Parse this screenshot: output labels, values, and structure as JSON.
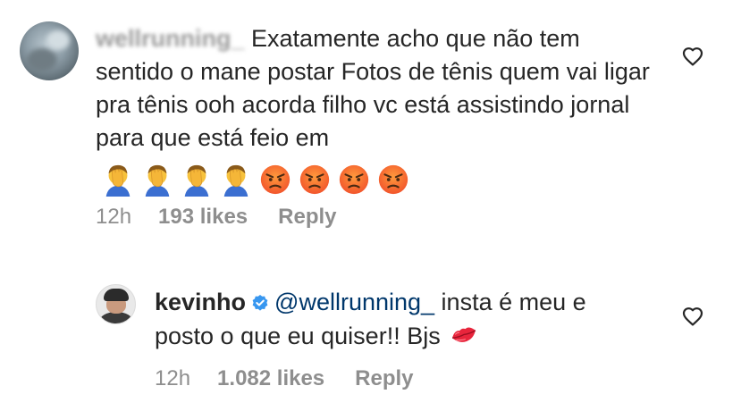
{
  "comment_1": {
    "username": "wellrunning_",
    "text": "Exatamente acho que não tem sentido o mane postar Fotos de tênis quem vai ligar pra tênis ooh acorda filho vc está assistindo jornal para que está feio em",
    "emojis": [
      "man-facepalming-icon",
      "man-facepalming-icon",
      "man-facepalming-icon",
      "man-facepalming-icon",
      "angry-face-icon",
      "angry-face-icon",
      "angry-face-icon",
      "angry-face-icon"
    ],
    "time": "12h",
    "likes": "193 likes",
    "reply_label": "Reply"
  },
  "comment_2": {
    "username": "kevinho",
    "mention": "@wellrunning_",
    "text": " insta é meu e posto o que eu quiser!! Bjs ",
    "emoji": "kiss-mark-icon",
    "time": "12h",
    "likes": "1.082 likes",
    "reply_label": "Reply"
  },
  "colors": {
    "text": "#262626",
    "secondary": "#8e8e8e",
    "mention": "#00376b",
    "verified": "#3897f0"
  }
}
